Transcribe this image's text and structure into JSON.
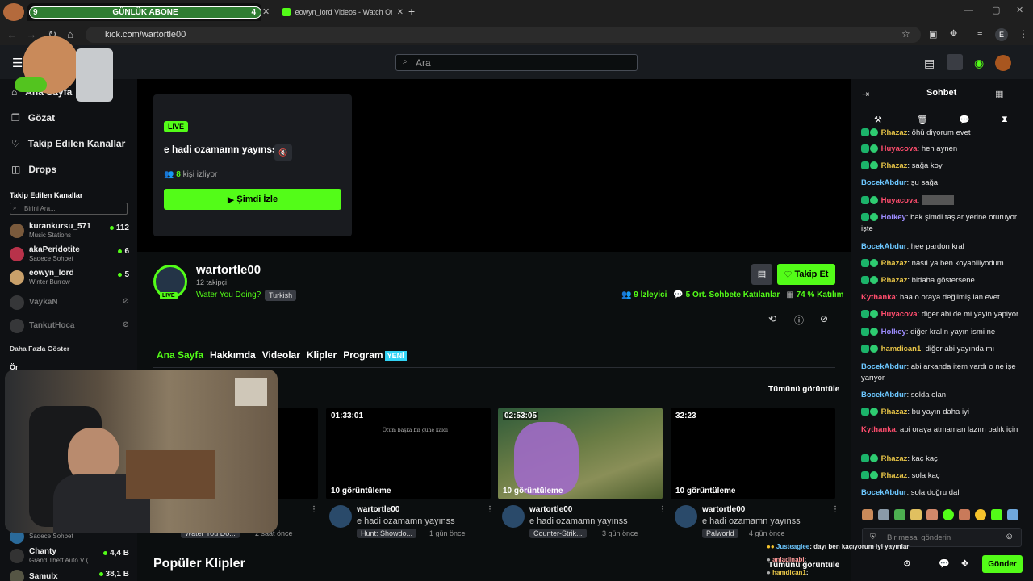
{
  "browser": {
    "tab1": {
      "left_count": "9",
      "label": "GÜNLÜK ABONE",
      "right_count": "4"
    },
    "tab2": {
      "title": "eowyn_lord Videos - Watch On"
    },
    "url": "kick.com/wartortle00",
    "profile_initial": "E"
  },
  "header": {
    "search_placeholder": "Ara"
  },
  "sidebar": {
    "nav": [
      "Ana Sayfa",
      "Gözat",
      "Takip Edilen Kanallar",
      "Drops"
    ],
    "followed_title": "Takip Edilen Kanallar",
    "filter_placeholder": "Birini Ara...",
    "channels": [
      {
        "name": "kurankursu_571",
        "game": "Music Stations",
        "count": "112"
      },
      {
        "name": "akaPeridotite",
        "game": "Sadece Sohbet",
        "count": "6"
      },
      {
        "name": "eowyn_lord",
        "game": "Winter Burrow",
        "count": "5"
      },
      {
        "name": "VaykaN",
        "game": "",
        "count": ""
      },
      {
        "name": "TankutHoca",
        "game": "",
        "count": ""
      }
    ],
    "show_more": "Daha Fazla Göster",
    "rec_partial": "Ör",
    "recommended": [
      {
        "name": "",
        "game": "Sadece Sohbet",
        "count": ""
      },
      {
        "name": "Chanty",
        "game": "Grand Theft Auto V (...",
        "count": "4,4 B"
      },
      {
        "name": "Samulx",
        "game": "",
        "count": "38,1 B"
      }
    ]
  },
  "offline": {
    "live_badge": "LIVE",
    "title": "e hadi ozamamn yayınss",
    "viewers_num": "8",
    "viewers_label": "kişi izliyor",
    "watch_button": "Şimdi İzle"
  },
  "channel": {
    "name": "wartortle00",
    "followers": "12 takipçi",
    "game": "Water You Doing?",
    "language": "Turkish",
    "live_badge": "LIVE",
    "follow_button": "Takip Et",
    "stats": {
      "viewers": "9",
      "viewers_label": "İzleyici",
      "avg_chat": "5",
      "avg_chat_label": "Ort. Sohbete Katılanlar",
      "percent": "74",
      "percent_label": "% Katılım"
    }
  },
  "tabs": [
    "Ana Sayfa",
    "Hakkımda",
    "Videolar",
    "Klipler",
    "Program"
  ],
  "tab_new_badge": "YENİ",
  "videos_section": {
    "view_all": "Tümünü görüntüle"
  },
  "videos": [
    {
      "duration": "",
      "views": "",
      "user": "",
      "title": "",
      "category": "Water You Do...",
      "ago": "2 saat önce"
    },
    {
      "duration": "01:33:01",
      "views": "10 görüntüleme",
      "overlay_text": "Ötüm başka bir güne kaldı",
      "user": "wartortle00",
      "title": "e hadi ozamamn yayınss",
      "category": "Hunt: Showdo...",
      "ago": "1 gün önce"
    },
    {
      "duration": "02:53:05",
      "views": "10 görüntüleme",
      "user": "wartortle00",
      "title": "e hadi ozamamn yayınss",
      "category": "Counter-Strik...",
      "ago": "3 gün önce"
    },
    {
      "duration": "32:23",
      "views": "10 görüntüleme",
      "user": "wartortle00",
      "title": "e hadi ozamamn yayınss",
      "category": "Palworld",
      "ago": "4 gün önce"
    }
  ],
  "popular_clips": {
    "title": "Popüler Klipler",
    "view_all": "Tümünü görüntüle"
  },
  "chat": {
    "title": "Sohbet",
    "messages": [
      {
        "user": "Rhazaz",
        "text": "öhü diyorum evet",
        "color": "#e8c547",
        "badge": true
      },
      {
        "user": "Huyacova",
        "text": "heh aynen",
        "color": "#ff4d6d",
        "badge": true
      },
      {
        "user": "Rhazaz",
        "text": "sağa koy",
        "color": "#e8c547",
        "badge": true
      },
      {
        "user": "BocekAbdur",
        "text": "şu sağa",
        "color": "#6cc7ff",
        "badge": false
      },
      {
        "user": "Huyacova",
        "text": "",
        "color": "#ff4d6d",
        "badge": true
      },
      {
        "user": "Holkey",
        "text": "bak şimdi taşlar yerine oturuyor işte",
        "color": "#9d8cff",
        "badge": true
      },
      {
        "user": "BocekAbdur",
        "text": "hee pardon kral",
        "color": "#6cc7ff",
        "badge": false
      },
      {
        "user": "Rhazaz",
        "text": "nasıl ya ben koyabiliyodum",
        "color": "#e8c547",
        "badge": true
      },
      {
        "user": "Rhazaz",
        "text": "bidaha göstersene",
        "color": "#e8c547",
        "badge": true
      },
      {
        "user": "Kythanka",
        "text": "haa o oraya değilmiş lan evet",
        "color": "#ff4d6d",
        "badge": false
      },
      {
        "user": "Huyacova",
        "text": "diger abi de mi yayin yapiyor",
        "color": "#ff4d6d",
        "badge": true
      },
      {
        "user": "Holkey",
        "text": "diğer kralın yayın ismi ne",
        "color": "#9d8cff",
        "badge": true
      },
      {
        "user": "hamdican1",
        "text": "diğer abi yayında mı",
        "color": "#e8c547",
        "badge": true
      },
      {
        "user": "BocekAbdur",
        "text": "abi arkanda item vardı o ne işe yarıyor",
        "color": "#6cc7ff",
        "badge": false
      },
      {
        "user": "BocekAbdur",
        "text": "solda olan",
        "color": "#6cc7ff",
        "badge": false
      },
      {
        "user": "Rhazaz",
        "text": "bu yayın daha iyi",
        "color": "#e8c547",
        "badge": true
      },
      {
        "user": "Kythanka",
        "text": "abi oraya atmaman lazım balık için",
        "color": "#ff4d6d",
        "badge": false
      },
      {
        "user": "Rhazaz",
        "text": "kaç kaç",
        "color": "#e8c547",
        "badge": true
      },
      {
        "user": "Rhazaz",
        "text": "sola kaç",
        "color": "#e8c547",
        "badge": true
      },
      {
        "user": "BocekAbdur",
        "text": "sola doğru dal",
        "color": "#6cc7ff",
        "badge": false
      }
    ],
    "input_placeholder": "Bir mesaj gönderin",
    "send_button": "Gönder",
    "overlay_lines": [
      {
        "user": "Justeaglee",
        "text": "dayı ben kaçıyorum iyi yayınlar"
      },
      {
        "user": "anladinabi",
        "text": ""
      },
      {
        "user": "hamdican1",
        "text": ""
      }
    ]
  },
  "colors": {
    "accent": "#53fc18",
    "bg": "#0b0e0f",
    "panel": "#191b1f"
  }
}
